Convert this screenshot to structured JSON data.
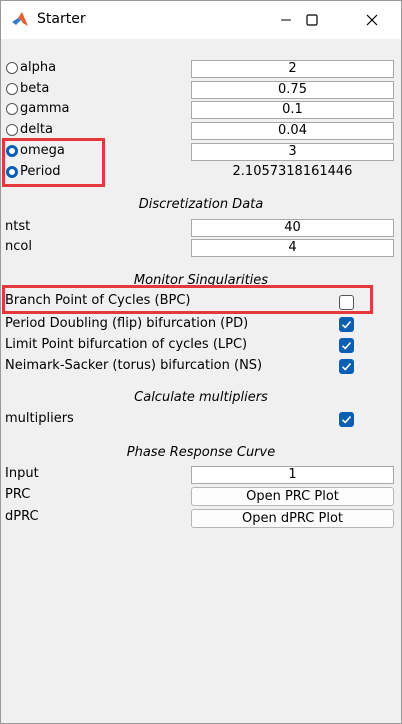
{
  "window": {
    "title": "Starter"
  },
  "parameters": [
    {
      "label": "alpha",
      "value": "2",
      "selected": false
    },
    {
      "label": "beta",
      "value": "0.75",
      "selected": false
    },
    {
      "label": "gamma",
      "value": "0.1",
      "selected": false
    },
    {
      "label": "delta",
      "value": "0.04",
      "selected": false
    },
    {
      "label": "omega",
      "value": "3",
      "selected": true
    },
    {
      "label": "Period",
      "value": "2.1057318161446",
      "selected": true
    }
  ],
  "discretization": {
    "header": "Discretization Data",
    "ntst": {
      "label": "ntst",
      "value": "40"
    },
    "ncol": {
      "label": "ncol",
      "value": "4"
    }
  },
  "monitor": {
    "header": "Monitor Singularities",
    "items": [
      {
        "label": "Branch Point of Cycles (BPC)",
        "checked": false
      },
      {
        "label": "Period Doubling (flip) bifurcation (PD)",
        "checked": true
      },
      {
        "label": "Limit Point bifurcation of cycles (LPC)",
        "checked": true
      },
      {
        "label": "Neimark-Sacker (torus) bifurcation (NS)",
        "checked": true
      }
    ]
  },
  "multipliers": {
    "header": "Calculate multipliers",
    "label": "multipliers",
    "checked": true
  },
  "prc": {
    "header": "Phase Response Curve",
    "input": {
      "label": "Input",
      "value": "1"
    },
    "prc": {
      "label": "PRC",
      "button": "Open PRC Plot"
    },
    "dprc": {
      "label": "dPRC",
      "button": "Open dPRC Plot"
    }
  },
  "colors": {
    "accent": "#0a5fb4",
    "highlight": "#e5383b"
  }
}
